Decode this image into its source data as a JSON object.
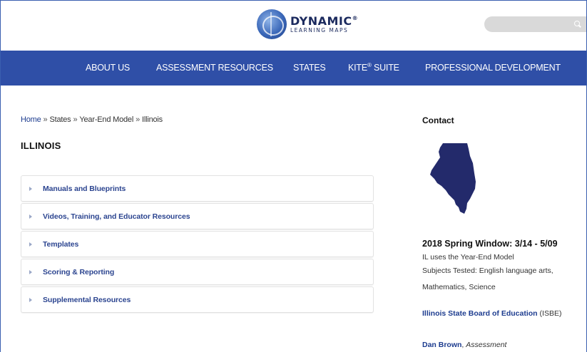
{
  "header": {
    "logo_main": "DYNAMIC",
    "logo_reg": "®",
    "logo_sub": "LEARNING MAPS",
    "search_placeholder": ""
  },
  "nav": {
    "items": [
      {
        "label": "ABOUT US"
      },
      {
        "label": "ASSESSMENT RESOURCES"
      },
      {
        "label": "STATES"
      },
      {
        "label": "KITE",
        "sup": "®",
        "suffix": " SUITE"
      },
      {
        "label": "PROFESSIONAL DEVELOPMENT"
      }
    ]
  },
  "breadcrumb": {
    "items": [
      "Home",
      "States",
      "Year-End Model",
      "Illinois"
    ],
    "separator": "»"
  },
  "page": {
    "title": "ILLINOIS"
  },
  "accordion": {
    "items": [
      {
        "label": "Manuals and Blueprints"
      },
      {
        "label": "Videos, Training, and Educator Resources"
      },
      {
        "label": "Templates"
      },
      {
        "label": "Scoring & Reporting"
      },
      {
        "label": "Supplemental Resources"
      }
    ]
  },
  "sidebar": {
    "heading": "Contact",
    "map_color": "#232a6b",
    "window_title": "2018 Spring Window: 3/14 - 5/09",
    "model_line": "IL uses the Year-End Model",
    "subjects_line1": "Subjects Tested: English language arts,",
    "subjects_line2": "Mathematics, Science",
    "board_link": "Illinois State Board of Education",
    "board_abbr": " (ISBE)",
    "contact_name": "Dan Brown",
    "contact_role": "Assessment"
  },
  "colors": {
    "nav_bg": "#2f4fa7",
    "link": "#1d3c8f"
  }
}
